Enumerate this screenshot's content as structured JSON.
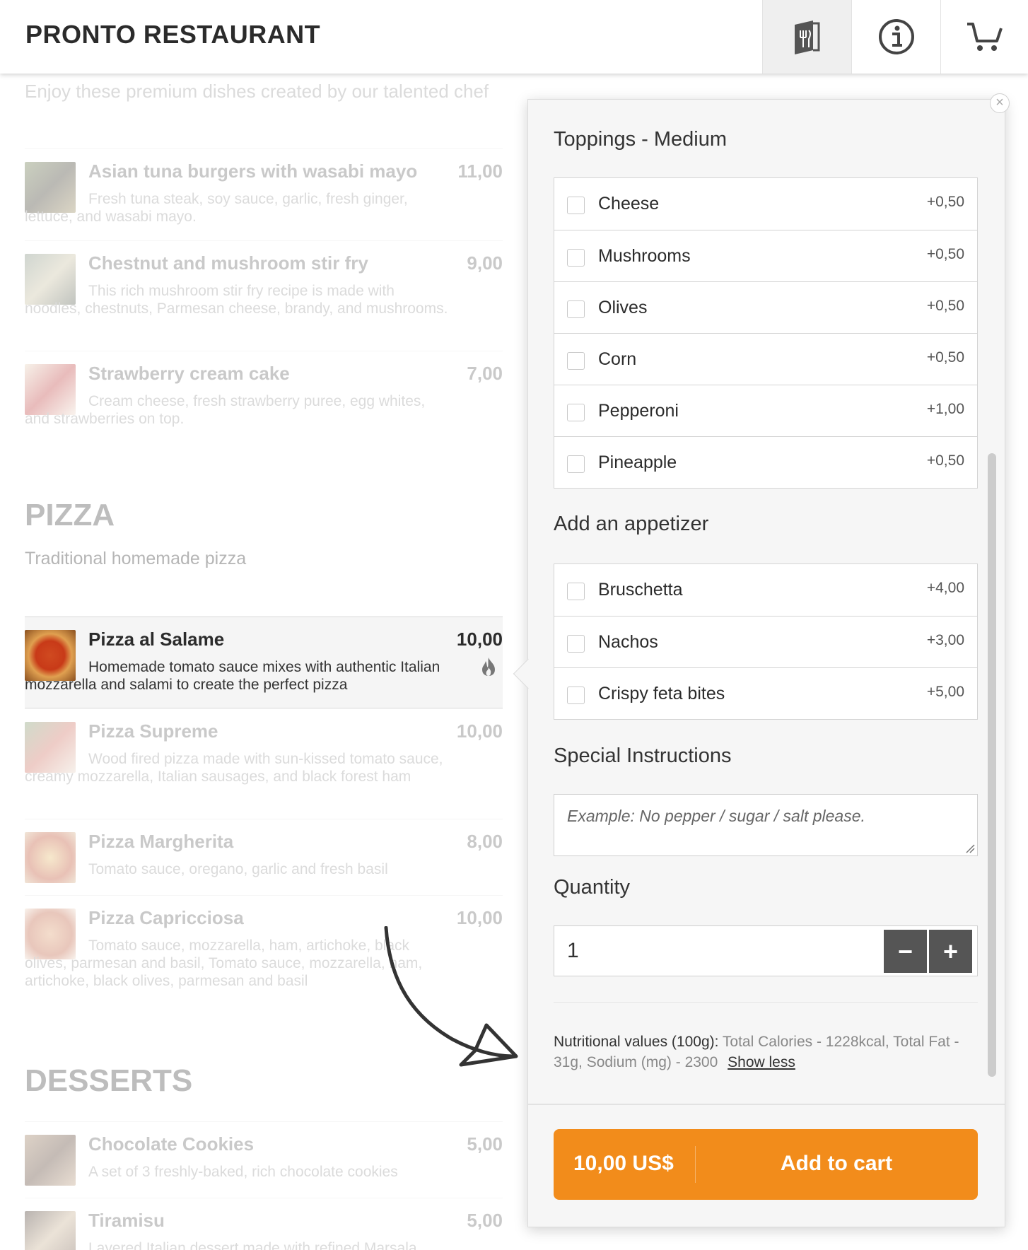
{
  "header": {
    "brand": "PRONTO RESTAURANT",
    "icons": [
      "menu-book-icon",
      "info-icon",
      "cart-icon"
    ]
  },
  "menu": {
    "intro": "Enjoy these premium dishes created by our talented chef",
    "items": [
      {
        "name": "Asian tuna burgers with wasabi mayo",
        "price": "11,00",
        "desc": "Fresh tuna steak, soy sauce, garlic, fresh ginger, lettuce, and wasabi mayo."
      },
      {
        "name": "Chestnut and mushroom stir fry",
        "price": "9,00",
        "desc": "This rich mushroom stir fry recipe is made with noodles, chestnuts, Parmesan cheese, brandy, and mushrooms."
      },
      {
        "name": "Strawberry cream cake",
        "price": "7,00",
        "desc": "Cream cheese, fresh strawberry puree, egg whites, and strawberries on top."
      }
    ],
    "pizza": {
      "title": "PIZZA",
      "subtitle": "Traditional homemade pizza",
      "items": [
        {
          "name": "Pizza al Salame",
          "price": "10,00",
          "desc": "Homemade tomato sauce mixes with authentic Italian mozzarella and salami to create the perfect pizza"
        },
        {
          "name": "Pizza Supreme",
          "price": "10,00",
          "desc": "Wood fired pizza made with sun-kissed tomato sauce, creamy mozzarella, Italian sausages, and black forest ham"
        },
        {
          "name": "Pizza Margherita",
          "price": "8,00",
          "desc": "Tomato sauce, oregano, garlic and fresh basil"
        },
        {
          "name": "Pizza Capricciosa",
          "price": "10,00",
          "desc": "Tomato sauce, mozzarella, ham, artichoke, black olives, parmesan and basil, Tomato sauce, mozzarella, ham, artichoke, black olives, parmesan and basil"
        }
      ]
    },
    "desserts": {
      "title": "DESSERTS",
      "items": [
        {
          "name": "Chocolate Cookies",
          "price": "5,00",
          "desc": "A set of 3 freshly-baked, rich chocolate cookies"
        },
        {
          "name": "Tiramisu",
          "price": "5,00",
          "desc": "Layered Italian dessert made with refined Marsala"
        }
      ]
    }
  },
  "modal": {
    "toppings_title": "Toppings - Medium",
    "toppings": [
      {
        "name": "Cheese",
        "price": "+0,50"
      },
      {
        "name": "Mushrooms",
        "price": "+0,50"
      },
      {
        "name": "Olives",
        "price": "+0,50"
      },
      {
        "name": "Corn",
        "price": "+0,50"
      },
      {
        "name": "Pepperoni",
        "price": "+1,00"
      },
      {
        "name": "Pineapple",
        "price": "+0,50"
      }
    ],
    "appetizer_title": "Add an appetizer",
    "appetizers": [
      {
        "name": "Bruschetta",
        "price": "+4,00"
      },
      {
        "name": "Nachos",
        "price": "+3,00"
      },
      {
        "name": "Crispy feta bites",
        "price": "+5,00"
      }
    ],
    "instructions_title": "Special Instructions",
    "instructions_placeholder": "Example: No pepper / sugar / salt please.",
    "quantity_title": "Quantity",
    "quantity": "1",
    "minus": "−",
    "plus": "+",
    "nutrition_label": "Nutritional values (100g):",
    "nutrition_values": "Total Calories - 1228kcal, Total Fat - 31g, Sodium (mg) - 2300",
    "show_less": "Show less",
    "close": "×",
    "cart_price": "10,00 US$",
    "cart_label": "Add to cart"
  },
  "colors": {
    "accent": "#f28c1b",
    "qty_button": "#555555"
  }
}
